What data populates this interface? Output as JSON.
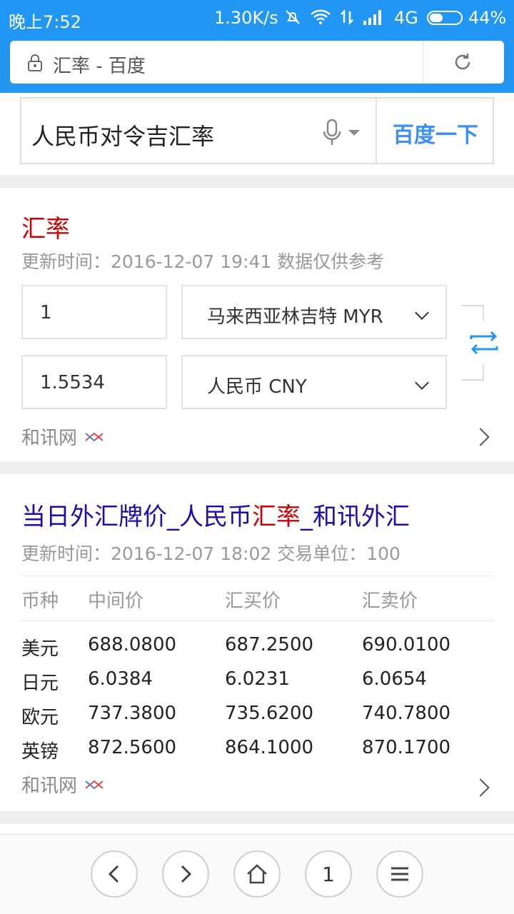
{
  "status": {
    "time": "晚上7:52",
    "speed": "1.30K/s",
    "network": "4G",
    "battery_pct": "44%",
    "battery_level": 0.44
  },
  "address_bar": {
    "text": "汇率 - 百度"
  },
  "search": {
    "query": "人民币对令吉汇率",
    "button_label": "百度一下"
  },
  "exchange_card": {
    "title": "汇率",
    "update_info": "更新时间：2016-12-07 19:41 数据仅供参考",
    "from_amount": "1",
    "from_currency": "马来西亚林吉特 MYR",
    "to_amount": "1.5534",
    "to_currency": "人民币 CNY",
    "source": "和讯网"
  },
  "rates_card": {
    "title_part1": "当日外汇牌价_人民币",
    "title_highlight": "汇率",
    "title_part2": "_和讯外汇",
    "update_info": "更新时间：2016-12-07 18:02 交易单位：100",
    "columns": [
      "币种",
      "中间价",
      "汇买价",
      "汇卖价"
    ],
    "rows": [
      [
        "美元",
        "688.0800",
        "687.2500",
        "690.0100"
      ],
      [
        "日元",
        "6.0384",
        "6.0231",
        "6.0654"
      ],
      [
        "欧元",
        "737.3800",
        "735.6200",
        "740.7800"
      ],
      [
        "英镑",
        "872.5600",
        "864.1000",
        "870.1700"
      ]
    ],
    "source": "和讯网"
  },
  "bottom_nav": {
    "tab_count": "1"
  },
  "colors": {
    "brand_blue": "#2196f3",
    "link_blue": "#1a0dab",
    "highlight_red": "#cc0000",
    "button_blue": "#3b8ff6"
  }
}
